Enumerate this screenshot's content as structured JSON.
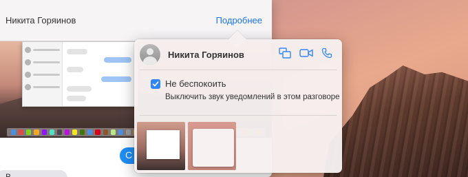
{
  "messages_window": {
    "contact_name": "Никита Горяинов",
    "details_link": "Подробнее",
    "send_bubble_text": "С",
    "received_bubble_text": "В..."
  },
  "details_popover": {
    "contact_name": "Никита Горяинов",
    "actions": [
      "screen-share-icon",
      "video-call-icon",
      "phone-call-icon"
    ],
    "do_not_disturb": {
      "label": "Не беспокоить",
      "checked": true,
      "description": "Выключить звук уведомлений в этом разговоре"
    },
    "attachments_count": 2
  },
  "colors": {
    "accent": "#1a73e8",
    "checkbox": "#2f86f6",
    "send_bubble": "#1e8ef7"
  }
}
